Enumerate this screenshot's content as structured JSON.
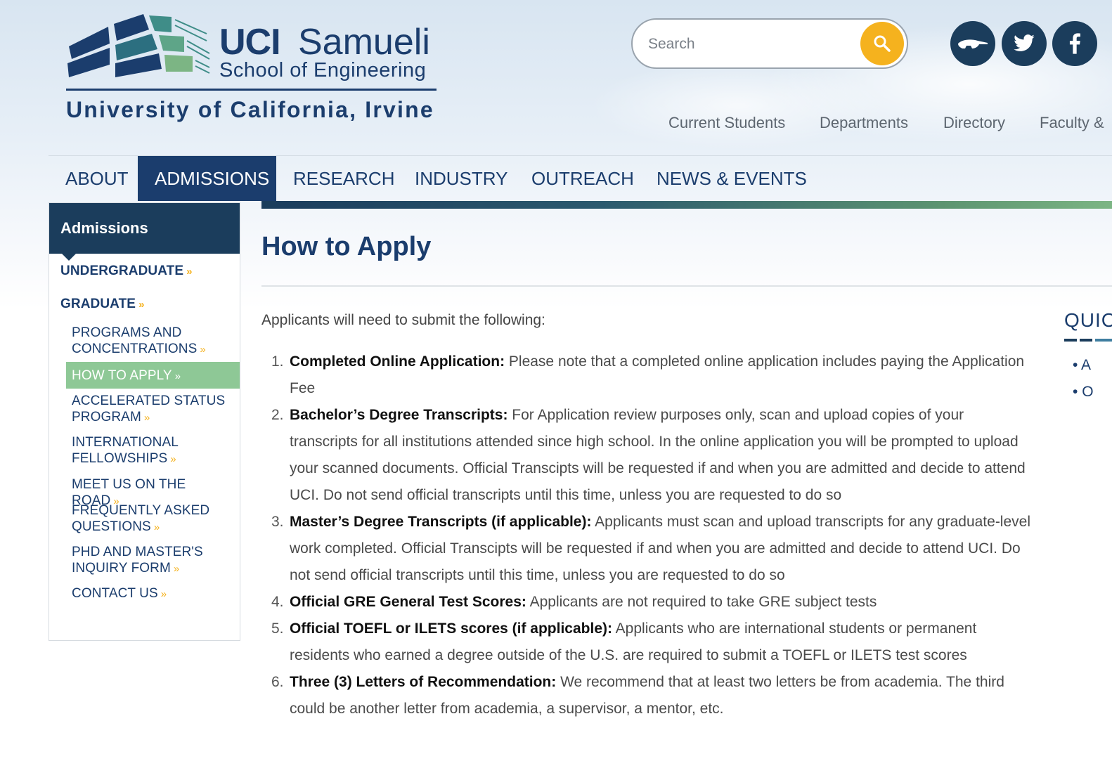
{
  "logo": {
    "uci": "UCI",
    "samueli": "Samueli",
    "school": "School of Engineering",
    "university": "University of California, Irvine"
  },
  "search": {
    "placeholder": "Search"
  },
  "social": [
    {
      "icon": "anteater-icon"
    },
    {
      "icon": "twitter-icon"
    },
    {
      "icon": "facebook-icon"
    }
  ],
  "util_nav": {
    "current_students": "Current Students",
    "departments": "Departments",
    "directory": "Directory",
    "faculty": "Faculty &"
  },
  "main_nav": {
    "about": "ABOUT",
    "admissions": "ADMISSIONS",
    "research": "RESEARCH",
    "industry": "INDUSTRY",
    "outreach": "OUTREACH",
    "news": "NEWS & EVENTS",
    "active": "ADMISSIONS"
  },
  "sidebar": {
    "heading": "Admissions",
    "undergraduate": "UNDERGRADUATE",
    "graduate": "GRADUATE",
    "programs_1": "PROGRAMS AND",
    "programs_2": "CONCENTRATIONS",
    "how_to_apply": "HOW TO APPLY",
    "accelerated_1": "ACCELERATED STATUS",
    "accelerated_2": "PROGRAM",
    "international_1": "INTERNATIONAL",
    "international_2": "FELLOWSHIPS",
    "meet": "MEET US ON THE ROAD",
    "faq_1": "FREQUENTLY ASKED",
    "faq_2": "QUESTIONS",
    "inquiry_1": "PHD AND MASTER'S",
    "inquiry_2": "INQUIRY FORM",
    "contact": "CONTACT US",
    "chevron": "»"
  },
  "content": {
    "title": "How to Apply",
    "intro": "Applicants will need to submit the following:",
    "requirements": [
      {
        "num": "1.",
        "label": "Completed Online Application:",
        "text": " Please note that a completed online application includes paying the Application Fee"
      },
      {
        "num": "2.",
        "label": "Bachelor’s Degree Transcripts:",
        "text": " For Application review purposes only, scan and upload copies of your transcripts for all institutions attended since high school. In the online application you will be prompted to upload your scanned documents. Official Transcipts will be requested if and when you are admitted and decide to attend UCI. Do not send official transcripts until this time, unless you are requested to do so"
      },
      {
        "num": "3.",
        "label": "Master’s Degree Transcripts (if applicable):",
        "text": " Applicants must scan and upload transcripts for any graduate-level work completed. Official Transcipts will be requested if and when you are admitted and decide to attend UCI. Do not send official transcripts until this time, unless you are requested to do so"
      },
      {
        "num": "4.",
        "label": "Official GRE General Test Scores:",
        "text": " Applicants are not required to take GRE subject tests"
      },
      {
        "num": "5.",
        "label": "Official TOEFL or ILETS scores (if applicable):",
        "text": " Applicants who are international students or permanent residents who earned a degree outside of the U.S. are required to submit a TOEFL or ILETS test scores"
      },
      {
        "num": "6.",
        "label": "Three (3) Letters of Recommendation:",
        "text": " We recommend that at least two letters be from academia. The third could be another letter from academia, a supervisor, a mentor, etc."
      }
    ]
  },
  "quick": {
    "heading": "QUIC",
    "item_1": "A",
    "item_2": "O"
  },
  "colors": {
    "navy": "#1b3d6d",
    "sidebar_head": "#1b3d5c",
    "gold": "#f5b21e",
    "active_green": "#8ec896"
  }
}
